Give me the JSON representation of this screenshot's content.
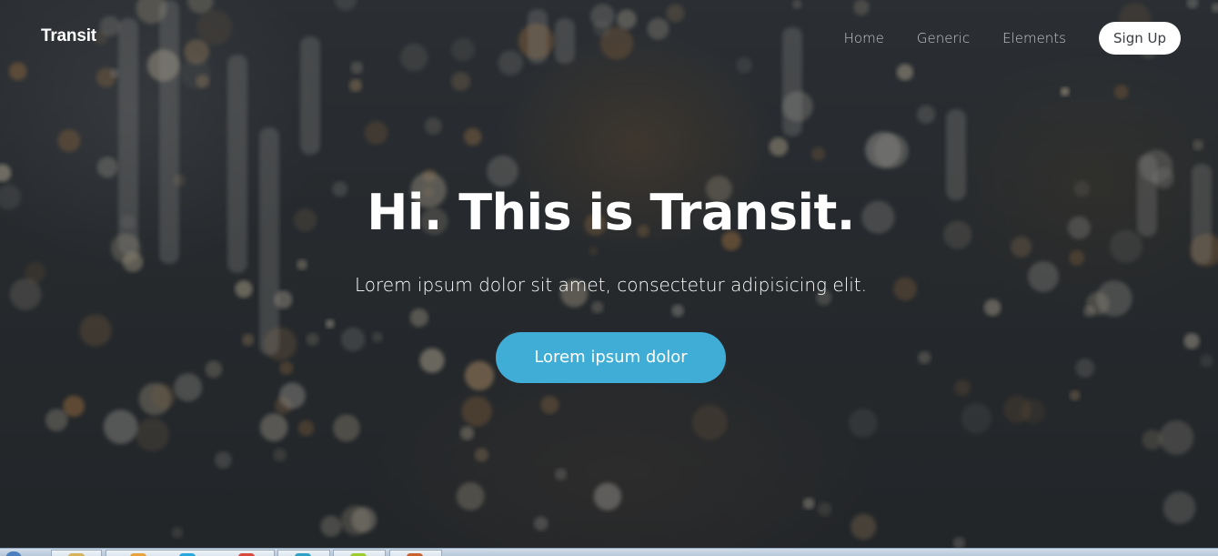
{
  "header": {
    "logo": "Transit",
    "nav": [
      {
        "label": "Home"
      },
      {
        "label": "Generic"
      },
      {
        "label": "Elements"
      }
    ],
    "signup_label": "Sign Up"
  },
  "hero": {
    "title": "Hi. This is Transit.",
    "subtitle": "Lorem ipsum dolor sit amet, consectetur adipisicing elit.",
    "button_label": "Lorem ipsum dolor"
  },
  "colors": {
    "accent": "#3fadd6",
    "text": "#ffffff",
    "background": "#2a2d31"
  },
  "taskbar": {
    "icons": [
      "start-orb-icon",
      "folder-icon",
      "browser-icon",
      "skype-icon",
      "chrome-icon",
      "app-icon",
      "terminal-icon",
      "image-icon"
    ]
  }
}
